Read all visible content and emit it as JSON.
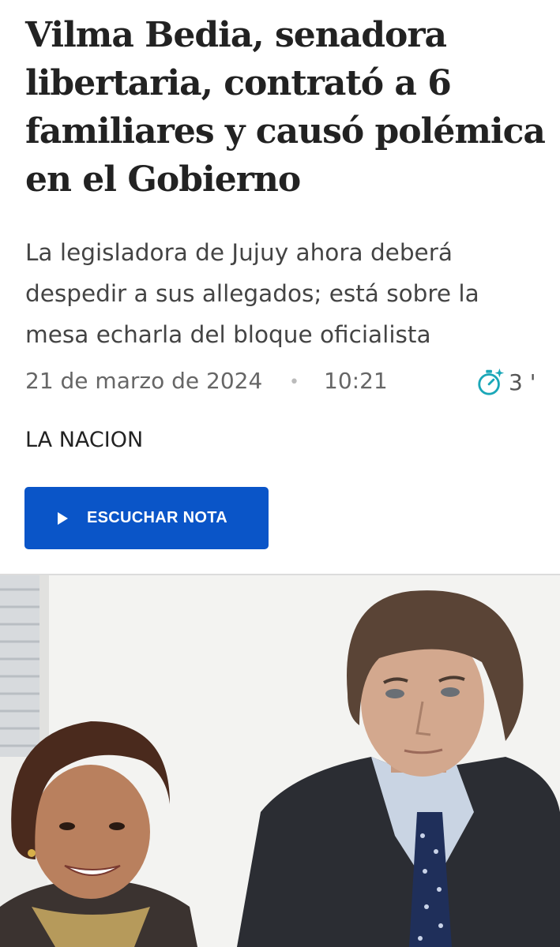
{
  "article": {
    "headline": "Vilma Bedia, senadora libertaria, contrató a 6 familiares y causó polémica en el Gobierno",
    "subtitle": "La legisladora de Jujuy ahora deberá despedir a sus allegados; está sobre la mesa echarla del bloque oficialista",
    "date": "21 de marzo de 2024",
    "separator": "•",
    "time": "10:21",
    "reading_time": "3 '",
    "source": "LA NACION",
    "listen_button_label": "ESCUCHAR NOTA",
    "icons": {
      "reading_time": "stopwatch-sparkle-icon",
      "listen": "play-icon"
    }
  },
  "colors": {
    "headline": "#222222",
    "subtitle": "#444444",
    "meta": "#666666",
    "button_bg": "#0a55c8",
    "button_text": "#ffffff",
    "icon_accent": "#1aa7b8"
  }
}
